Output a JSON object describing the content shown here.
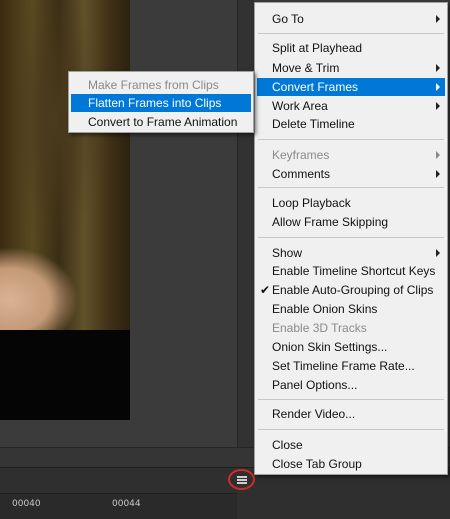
{
  "timeline": {
    "ticks": [
      "00040",
      "00044"
    ]
  },
  "main_menu": {
    "items": [
      {
        "label": "Go To",
        "submenu": true
      },
      {
        "label": "Split at Playhead"
      },
      {
        "label": "Move & Trim",
        "submenu": true
      },
      {
        "label": "Convert Frames",
        "submenu": true,
        "highlighted": true
      },
      {
        "label": "Work Area",
        "submenu": true
      },
      {
        "label": "Delete Timeline"
      },
      {
        "label": "Keyframes",
        "submenu": true,
        "disabled": true
      },
      {
        "label": "Comments",
        "submenu": true
      },
      {
        "label": "Loop Playback"
      },
      {
        "label": "Allow Frame Skipping"
      },
      {
        "label": "Show",
        "submenu": true
      },
      {
        "label": "Enable Timeline Shortcut Keys"
      },
      {
        "label": "Enable Auto-Grouping of Clips",
        "checked": true
      },
      {
        "label": "Enable Onion Skins"
      },
      {
        "label": "Enable 3D Tracks",
        "disabled": true
      },
      {
        "label": "Onion Skin Settings..."
      },
      {
        "label": "Set Timeline Frame Rate..."
      },
      {
        "label": "Panel Options..."
      },
      {
        "label": "Render Video..."
      },
      {
        "label": "Close"
      },
      {
        "label": "Close Tab Group"
      }
    ]
  },
  "sub_menu": {
    "items": [
      {
        "label": "Make Frames from Clips",
        "disabled": true
      },
      {
        "label": "Flatten Frames into Clips",
        "highlighted": true
      },
      {
        "label": "Convert to Frame Animation"
      }
    ]
  },
  "colors": {
    "highlight": "#0078d7",
    "annotation_circle": "#d22a2a"
  }
}
